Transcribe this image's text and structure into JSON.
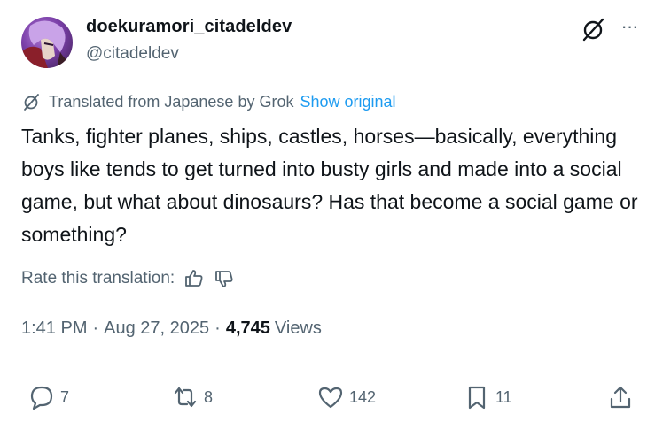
{
  "user": {
    "display_name": "doekuramori_citadeldev",
    "handle": "@citadeldev"
  },
  "header": {
    "grok_icon": "grok-icon",
    "more_label": "···"
  },
  "translation": {
    "note": "Translated from Japanese by Grok",
    "show_original": "Show original"
  },
  "tweet": {
    "text": "Tanks, fighter planes, ships, castles, horses—basically, everything boys like tends to get turned into busty girls and made into a social game, but what about dinosaurs? Has that become a social game or something?"
  },
  "rate": {
    "label": "Rate this translation:"
  },
  "meta": {
    "time": "1:41 PM",
    "separator": "·",
    "date": "Aug 27, 2025",
    "views_count": "4,745",
    "views_label": "Views"
  },
  "actions": {
    "replies": "7",
    "reposts": "8",
    "likes": "142",
    "bookmarks": "11"
  },
  "colors": {
    "text": "#0f1419",
    "secondary": "#536471",
    "link": "#1d9bf0"
  }
}
